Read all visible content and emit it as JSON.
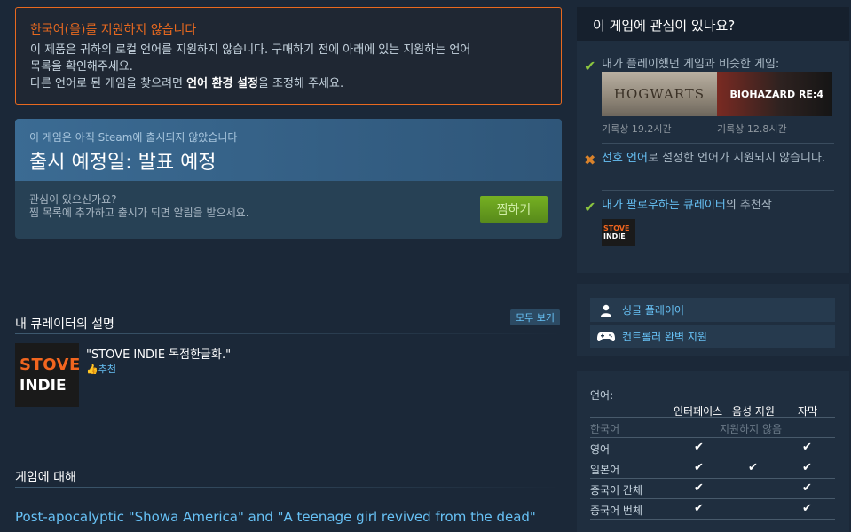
{
  "warning": {
    "title": "한국어(을)를 지원하지 않습니다",
    "line1": "이 제품은 귀하의 로컬 언어를 지원하지 않습니다. 구매하기 전에 아래에 있는 지원하는 언어",
    "line2": "목록을 확인해주세요.",
    "line3_pre": "다른 언어로 된 게임을 찾으려면 ",
    "line3_bold": "언어 환경 설정",
    "line3_post": "을 조정해 주세요."
  },
  "release": {
    "subtitle": "이 게임은 아직 Steam에 출시되지 않았습니다",
    "title": "출시 예정일: 발표 예정",
    "interest_q": "관심이 있으신가요?",
    "interest_desc": "찜 목록에 추가하고 출시가 되면 알림을 받으세요.",
    "wishlist_label": "찜하기"
  },
  "curator_section": {
    "title": "내 큐레이터의 설명",
    "see_all": "모두 보기",
    "logo_line1": "STOVE",
    "logo_line2": "INDIE",
    "quote": "\"STOVE INDIE 독점한글화.\"",
    "recommend": "추천"
  },
  "about": {
    "title": "게임에 대해",
    "description": "Post-apocalyptic \"Showa America\" and \"A teenage girl revived from the dead\""
  },
  "interest_panel": {
    "title": "이 게임에 관심이 있나요?",
    "reason1": "내가 플레이했던 게임과 비슷한 게임:",
    "game1_caption": "HOGWARTS",
    "game1_time": "기록상 19.2시간",
    "game2_caption": "BIOHAZARD RE:4",
    "game2_time": "기록상 12.8시간",
    "reason2_link": "선호 언어",
    "reason2_rest": "로 설정한 언어가 지원되지 않습니다.",
    "reason3_link": "내가 팔로우하는 큐레이터",
    "reason3_rest": "의 추천작",
    "mini_logo_line1": "STOVE",
    "mini_logo_line2": "INDIE"
  },
  "features": [
    {
      "label": "싱글 플레이어",
      "icon": "user-icon"
    },
    {
      "label": "컨트롤러 완벽 지원",
      "icon": "gamepad-icon"
    }
  ],
  "languages": {
    "title": "언어:",
    "headers": [
      "인터페이스",
      "음성 지원",
      "자막"
    ],
    "not_supported_text": "지원하지 않음",
    "rows": [
      {
        "name": "한국어",
        "supported": false,
        "interface": false,
        "audio": false,
        "subtitles": false
      },
      {
        "name": "영어",
        "supported": true,
        "interface": true,
        "audio": false,
        "subtitles": true
      },
      {
        "name": "일본어",
        "supported": true,
        "interface": true,
        "audio": true,
        "subtitles": true
      },
      {
        "name": "중국어 간체",
        "supported": true,
        "interface": true,
        "audio": false,
        "subtitles": true
      },
      {
        "name": "중국어 번체",
        "supported": true,
        "interface": true,
        "audio": false,
        "subtitles": true
      }
    ],
    "check_glyph": "✔"
  },
  "colors": {
    "background": "#1b2838",
    "warning_accent": "#e8691f",
    "link": "#67c1f5",
    "wishlist_green": "#75b022"
  }
}
